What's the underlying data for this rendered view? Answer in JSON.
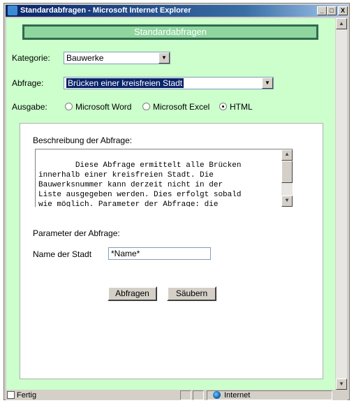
{
  "window": {
    "title": "Standardabfragen - Microsoft Internet Explorer",
    "min_glyph": "_",
    "max_glyph": "□",
    "close_glyph": "X"
  },
  "header": {
    "title": "Standardabfragen"
  },
  "form": {
    "kategorie_label": "Kategorie:",
    "kategorie_value": "Bauwerke",
    "abfrage_label": "Abfrage:",
    "abfrage_value": "Brücken einer kreisfreien Stadt",
    "ausgabe_label": "Ausgabe:",
    "ausgabe_options": [
      {
        "label": "Microsoft Word",
        "selected": false
      },
      {
        "label": "Microsoft Excel",
        "selected": false
      },
      {
        "label": "HTML",
        "selected": true
      }
    ]
  },
  "panel": {
    "desc_label": "Beschreibung der Abfrage:",
    "desc_text": "Diese Abfrage ermittelt alle Brücken\ninnerhalb einer kreisfreien Stadt. Die\nBauwerksnummer kann derzeit nicht in der\nListe ausgegeben werden. Dies erfolgt sobald\nwie möglich. Parameter der Abfrage: die",
    "params_label": "Parameter der Abfrage:",
    "stadt_label": "Name der Stadt",
    "stadt_value": "*Name*",
    "submit_label": "Abfragen",
    "reset_label": "Säubern"
  },
  "statusbar": {
    "status_text": "Fertig",
    "zone_label": "Internet",
    "zone_icon": "globe-icon"
  },
  "colors": {
    "background": "#ccffcc",
    "header_fill": "#8fd59e",
    "header_border": "#2f6b4f",
    "selection": "#0a246a"
  }
}
